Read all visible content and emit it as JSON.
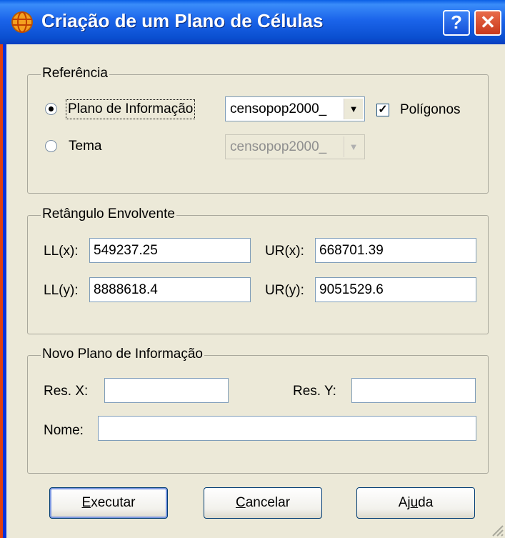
{
  "window": {
    "title": "Criação de um Plano de Células",
    "help_label": "?",
    "close_label": "✕"
  },
  "referencia": {
    "legend": "Referência",
    "radio_plano_label": "Plano de Informação",
    "radio_plano_selected": true,
    "combo_plano_value": "censopop2000_",
    "poligonos_label": "Polígonos",
    "poligonos_checked": true,
    "radio_tema_label": "Tema",
    "combo_tema_value": "censopop2000_"
  },
  "retangulo": {
    "legend": "Retângulo Envolvente",
    "llx_label": "LL(x):",
    "llx_value": "549237.25",
    "urx_label": "UR(x):",
    "urx_value": "668701.39",
    "lly_label": "LL(y):",
    "lly_value": "8888618.4",
    "ury_label": "UR(y):",
    "ury_value": "9051529.6"
  },
  "novo_plano": {
    "legend": "Novo Plano de Informação",
    "resx_label": "Res. X:",
    "resx_value": "",
    "resy_label": "Res. Y:",
    "resy_value": "",
    "nome_label": "Nome:",
    "nome_value": ""
  },
  "buttons": {
    "executar_mnemonic": "E",
    "executar_rest": "xecutar",
    "cancelar_mnemonic": "C",
    "cancelar_rest": "ancelar",
    "ajuda_pre": "Aj",
    "ajuda_mnemonic": "u",
    "ajuda_post": "da"
  },
  "colors": {
    "titlebar": "#0a4fd0",
    "dialog_bg": "#ece9d8",
    "close_button": "#c9391c"
  },
  "icons": {
    "app": "globe-icon",
    "dropdown": "chevron-down-icon",
    "resize": "resize-grip-icon"
  }
}
